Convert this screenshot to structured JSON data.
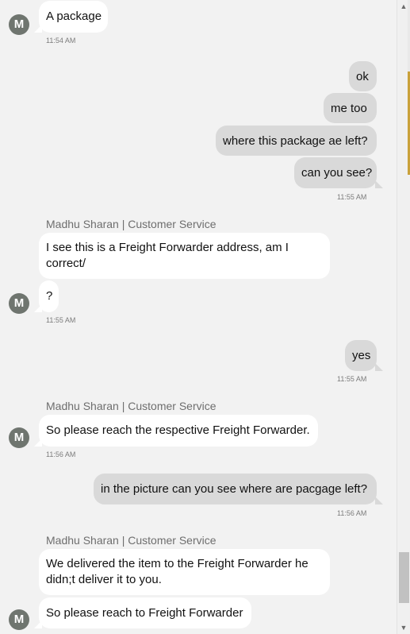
{
  "avatar_letter": "M",
  "sender_name": "Madhu Sharan | Customer Service",
  "messages": {
    "m1": "A package",
    "t1": "11:54 AM",
    "u1": "ok",
    "u2": "me too",
    "u3": "where this package ae left?",
    "u4": "can you see?",
    "t2": "11:55 AM",
    "m2": "I see this is a Freight Forwarder address, am I correct/",
    "m3": "?",
    "t3": "11:55 AM",
    "u5": "yes",
    "t4": "11:55 AM",
    "m4": "So please reach the respective Freight Forwarder.",
    "t5": "11:56 AM",
    "u6": "in the picture can you see where are pacgage left?",
    "t6": "11:56 AM",
    "m5": "We delivered the item to the  Freight Forwarder he didn;t deliver it to you.",
    "m6": "So please reach to Freight Forwarder"
  },
  "scrollbar": {
    "up_icon": "chevron-up-icon",
    "down_icon": "chevron-down-icon"
  }
}
